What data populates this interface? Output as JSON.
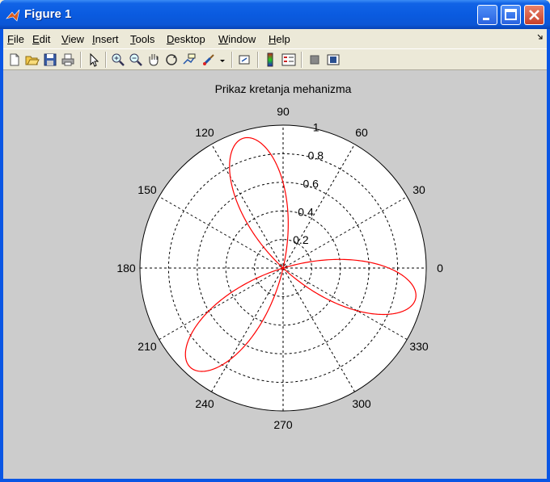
{
  "window": {
    "title": "Figure 1"
  },
  "menu": [
    "File",
    "Edit",
    "View",
    "Insert",
    "Tools",
    "Desktop",
    "Window",
    "Help"
  ],
  "toolbar_icons": [
    "new-figure-icon",
    "open-file-icon",
    "save-icon",
    "print-icon",
    "select-arrow-icon",
    "zoom-in-icon",
    "zoom-out-icon",
    "pan-hand-icon",
    "rotate-3d-icon",
    "data-cursor-icon",
    "brush-icon",
    "dropdown-arrow-icon",
    "link-icon",
    "colorbar-icon",
    "legend-icon",
    "hide-plot-tools-icon",
    "show-plot-tools-icon"
  ],
  "chart_data": {
    "type": "polar",
    "title": "Prikaz kretanja mehanizma",
    "angle_ticks": [
      "0",
      "30",
      "60",
      "90",
      "120",
      "150",
      "180",
      "210",
      "240",
      "270",
      "300",
      "330"
    ],
    "radial_ticks": [
      "0.2",
      "0.4",
      "0.6",
      "0.8",
      "1"
    ],
    "rmax": 1,
    "grid": true,
    "series": [
      {
        "curve": "rose",
        "r_max": 0.95,
        "petals": 3,
        "petal_angles_deg": [
          107,
          215,
          348
        ],
        "color": "#ff0000"
      }
    ]
  }
}
